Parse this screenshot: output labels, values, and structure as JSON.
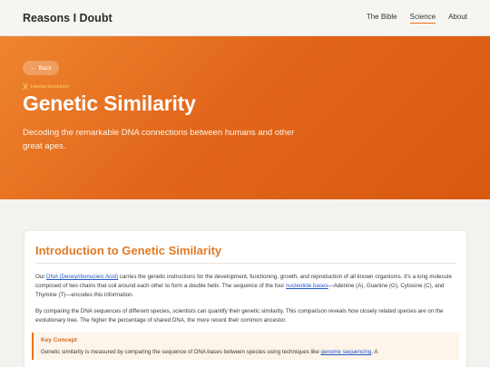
{
  "header": {
    "brand": "Reasons I Doubt",
    "nav": [
      {
        "label": "The Bible",
        "active": false
      },
      {
        "label": "Science",
        "active": true
      },
      {
        "label": "About",
        "active": false
      }
    ]
  },
  "hero": {
    "back_label": "Back",
    "back_icon": "arrow-left-icon",
    "eyebrow_icon": "dna-icon",
    "eyebrow": "Human Evolution",
    "title": "Genetic Similarity",
    "subtitle": "Decoding the remarkable DNA connections between humans and other great apes."
  },
  "section": {
    "title": "Introduction to Genetic Similarity",
    "p1": {
      "prefix": "Our ",
      "link1": "DNA (Deoxyribonucleic Acid)",
      "middle": " carries the genetic instructions for the development, functioning, growth, and reproduction of all known organisms. It's a long molecule composed of two chains that coil around each other to form a double helix. The sequence of the four ",
      "link2": "nucleotide bases",
      "suffix": "—Adenine (A), Guanine (G), Cytosine (C), and Thymine (T)—encodes this information."
    },
    "p2": "By comparing the DNA sequences of different species, scientists can quantify their genetic similarity. This comparison reveals how closely related species are on the evolutionary tree. The higher the percentage of shared DNA, the more recent their common ancestor.",
    "concept": {
      "title": "Key Concept",
      "text": "Genetic similarity is measured by comparing the sequence of DNA bases between species using techniques like ",
      "link": "genome sequencing",
      "suffix": ". A"
    }
  },
  "colors": {
    "accent": "#e9731b",
    "hero_start": "#ee8530",
    "hero_end": "#d8590f",
    "title_orange": "#e07a26",
    "link_blue": "#2356c9"
  }
}
